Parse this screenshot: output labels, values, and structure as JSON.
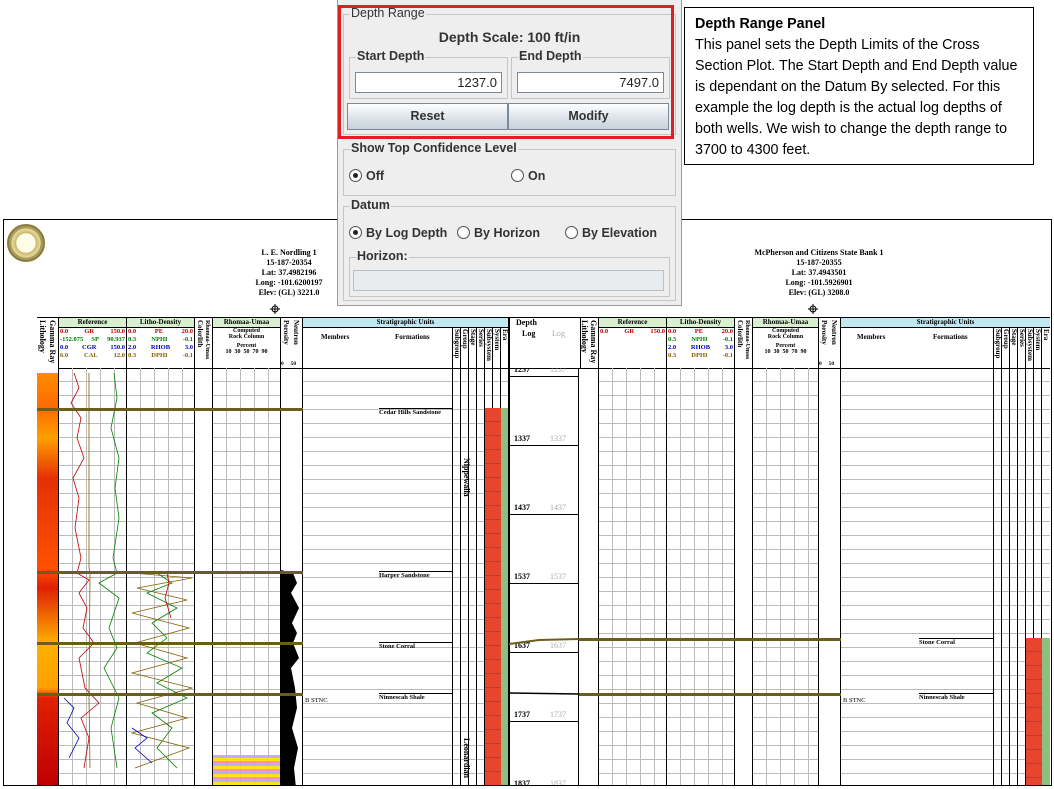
{
  "panel": {
    "depth_range": {
      "legend": "Depth Range",
      "scale_label": "Depth Scale: 100 ft/in",
      "start_depth_label": "Start Depth",
      "start_depth_value": "1237.0",
      "end_depth_label": "End Depth",
      "end_depth_value": "7497.0",
      "reset_button": "Reset",
      "modify_button": "Modify"
    },
    "top_confidence": {
      "legend": "Show Top Confidence Level",
      "options": [
        "Off",
        "On"
      ],
      "selected": "Off"
    },
    "datum": {
      "legend": "Datum",
      "options": [
        "By Log Depth",
        "By Horizon",
        "By Elevation"
      ],
      "selected": "By Log Depth",
      "horizon_label": "Horizon:",
      "horizon_value": ""
    },
    "highlight_color": "#e02020"
  },
  "callout": {
    "title": "Depth Range Panel",
    "body": "This panel sets the Depth Limits of the Cross Section Plot.  The Start Depth and End Depth value is dependant on the Datum By selected.  For this example the log depth is the actual log depths of both wells.  We wish to change the depth range to 3700 to 4300 feet."
  },
  "plot": {
    "wells": [
      {
        "name": "L. E. Nordling 1",
        "api": "15-187-20354",
        "lat": "Lat: 37.4982196",
        "long": "Long: -101.6200197",
        "elev": "Elev: (GL) 3221.0"
      },
      {
        "name": "McPherson and Citizens State Bank 1",
        "api": "15-187-20355",
        "lat": "Lat: 37.4943501",
        "long": "Long: -101.5926901",
        "elev": "Elev: (GL) 3208.0"
      }
    ],
    "track_headers": {
      "lithology": "Lithology",
      "gamma_ray": "Gamma Ray",
      "reference": "Reference",
      "litho_density": "Litho-Density",
      "colorlith": "Colorlith",
      "rhomaa_umaa": "Rhomaa-Umaa",
      "computed": "Computed",
      "rock_column": "Rock Column",
      "percent": "Percent",
      "percent_ticks": "10  30  50  70  90",
      "porosity": "Porosity",
      "neutron": "Neutron",
      "neutron_ticks": "0     50",
      "strat_units": "Stratigraphic Units",
      "members": "Members",
      "formations": "Formations",
      "strat_cols": [
        "Subgroup",
        "Group",
        "Stage",
        "Series",
        "Subsystem",
        "System",
        "Era"
      ],
      "depth": "Depth",
      "log": "Log"
    },
    "curves_left": [
      {
        "min": "0.0",
        "name": "GR",
        "max": "150.0",
        "color": "#c00000"
      },
      {
        "min": "-152.075",
        "name": "SP",
        "max": "90.937",
        "color": "#008000"
      },
      {
        "min": "0.0",
        "name": "CGR",
        "max": "150.0",
        "color": "#0000c0"
      },
      {
        "min": "6.0",
        "name": "CAL",
        "max": "12.0",
        "color": "#806000"
      }
    ],
    "curves_density": [
      {
        "min": "0.0",
        "name": "PE",
        "max": "20.0",
        "color": "#c00000"
      },
      {
        "min": "0.3",
        "name": "NPHI",
        "max": "-0.1",
        "color": "#008000"
      },
      {
        "min": "2.0",
        "name": "RHOB",
        "max": "3.0",
        "color": "#0000c0"
      },
      {
        "min": "0.3",
        "name": "DPHI",
        "max": "-0.1",
        "color": "#806000"
      }
    ],
    "curves_right_ref": [
      {
        "min": "0.0",
        "name": "GR",
        "max": "150.0",
        "color": "#c00000"
      }
    ],
    "depths": [
      "1237",
      "1337",
      "1437",
      "1537",
      "1637",
      "1737",
      "1837"
    ],
    "formations_left": [
      "Cedar Hills Sandstone",
      "Harper Sandstone",
      "Stone Corral",
      "Ninnescah Shale"
    ],
    "formations_right": [
      "Stone Corral",
      "Ninnescah Shale"
    ],
    "members_left": [
      "B STNC"
    ],
    "members_right": [
      "B STNC"
    ],
    "series_left": [
      "Nippewalla",
      "Leonardian"
    ]
  }
}
